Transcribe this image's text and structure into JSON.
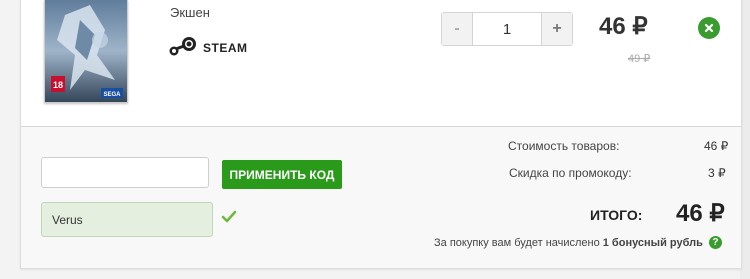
{
  "product": {
    "genre": "Экшен",
    "platform_label": "STEAM",
    "quantity": "1",
    "minus_label": "-",
    "plus_label": "+",
    "price": "46 ₽",
    "old_price": "49 ₽",
    "cover_age_rating": "18",
    "cover_publisher": "SEGA"
  },
  "promo": {
    "input_value": "",
    "apply_label": "ПРИМЕНИТЬ КОД",
    "applied_code": "Verus"
  },
  "summary": {
    "goods_cost_label": "Стоимость товаров:",
    "goods_cost_value": "46 ₽",
    "discount_label": "Скидка по промокоду:",
    "discount_value": "3 ₽",
    "total_label": "ИТОГО:",
    "total_value": "46 ₽",
    "bonus_text": "За покупку вам будет начислено",
    "bonus_amount": "1 бонусный рубль",
    "help_glyph": "?"
  },
  "colors": {
    "accent_green": "#2a9a1b",
    "applied_bg": "#e4efe0"
  },
  "icons": [
    "steam-icon",
    "remove-icon",
    "check-icon",
    "help-icon"
  ]
}
